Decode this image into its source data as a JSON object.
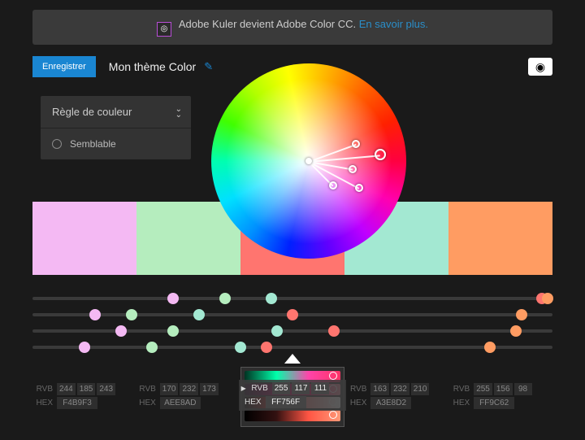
{
  "banner": {
    "text": "Adobe Kuler devient Adobe Color CC. ",
    "link_text": "En savoir plus."
  },
  "toolbar": {
    "save_label": "Enregistrer",
    "theme_title": "Mon thème Color"
  },
  "rule_panel": {
    "title": "Règle de couleur",
    "selected": "Semblable"
  },
  "swatches": [
    "#F4B9F3",
    "#B5EDBE",
    "#FF756F",
    "#A3E8D2",
    "#FF9C62"
  ],
  "wheel_markers": [
    {
      "angle": 90,
      "dist": 0,
      "center": true
    },
    {
      "angle": 20,
      "dist": 62,
      "small": true
    },
    {
      "angle": 350,
      "dist": 55,
      "small": true
    },
    {
      "angle": 5,
      "dist": 88
    },
    {
      "angle": 332,
      "dist": 70,
      "small": true
    },
    {
      "angle": 315,
      "dist": 42,
      "small": true
    }
  ],
  "wheel_lines": [
    {
      "angle": 20,
      "len": 62
    },
    {
      "angle": 350,
      "len": 55
    },
    {
      "angle": 5,
      "len": 88
    },
    {
      "angle": 332,
      "len": 70
    },
    {
      "angle": 315,
      "len": 42
    }
  ],
  "sliders": [
    {
      "handles": [
        {
          "pos": 27,
          "c": "#F4B9F3"
        },
        {
          "pos": 37,
          "c": "#B5EDBE"
        },
        {
          "pos": 98,
          "c": "#FF756F"
        },
        {
          "pos": 46,
          "c": "#A3E8D2"
        },
        {
          "pos": 99,
          "c": "#FF9C62"
        }
      ]
    },
    {
      "handles": [
        {
          "pos": 12,
          "c": "#F4B9F3"
        },
        {
          "pos": 19,
          "c": "#B5EDBE"
        },
        {
          "pos": 50,
          "c": "#FF756F"
        },
        {
          "pos": 32,
          "c": "#A3E8D2"
        },
        {
          "pos": 94,
          "c": "#FF9C62"
        }
      ]
    },
    {
      "handles": [
        {
          "pos": 17,
          "c": "#F4B9F3"
        },
        {
          "pos": 27,
          "c": "#B5EDBE"
        },
        {
          "pos": 58,
          "c": "#FF756F"
        },
        {
          "pos": 47,
          "c": "#A3E8D2"
        },
        {
          "pos": 93,
          "c": "#FF9C62"
        }
      ]
    },
    {
      "handles": [
        {
          "pos": 10,
          "c": "#F4B9F3"
        },
        {
          "pos": 23,
          "c": "#B5EDBE"
        },
        {
          "pos": 45,
          "c": "#FF756F"
        },
        {
          "pos": 40,
          "c": "#A3E8D2"
        },
        {
          "pos": 88,
          "c": "#FF9C62"
        }
      ]
    }
  ],
  "center_gradients": [
    "linear-gradient(90deg,#003322,#00ffaa,#ff44aa,#ff3366)",
    "linear-gradient(90deg,#220022,#bb0066,#ff0066,#ff99aa)",
    "linear-gradient(90deg,#000,#ff3333,#ff9999,#fff)",
    "linear-gradient(90deg,#000,#331111,#ff5544,#ff9977)"
  ],
  "labels": {
    "rvb": "RVB",
    "hex": "HEX"
  },
  "cols": [
    {
      "r": "244",
      "g": "185",
      "b": "243",
      "hex": "F4B9F3",
      "active": false
    },
    {
      "r": "170",
      "g": "232",
      "b": "173",
      "hex": "AEE8AD",
      "active": false
    },
    {
      "r": "255",
      "g": "117",
      "b": "111",
      "hex": "FF756F",
      "active": true
    },
    {
      "r": "163",
      "g": "232",
      "b": "210",
      "hex": "A3E8D2",
      "active": false
    },
    {
      "r": "255",
      "g": "156",
      "b": "98",
      "hex": "FF9C62",
      "active": false
    }
  ]
}
